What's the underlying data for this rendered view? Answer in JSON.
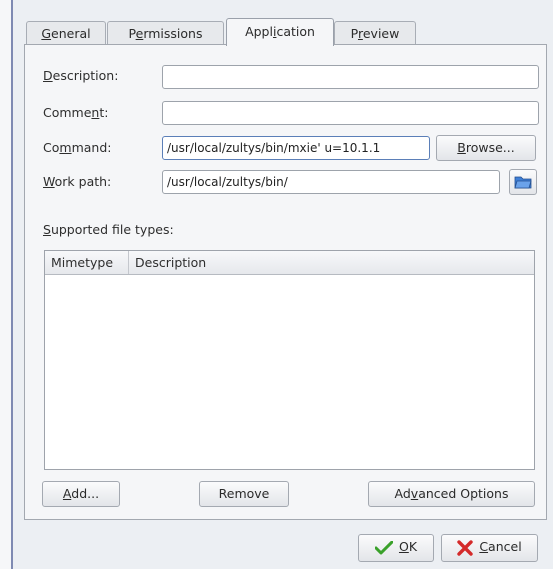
{
  "tabs": [
    {
      "label_pre": "",
      "label_ul": "G",
      "label_post": "eneral"
    },
    {
      "label_pre": "P",
      "label_ul": "e",
      "label_post": "rmissions"
    },
    {
      "label_pre": "Appl",
      "label_ul": "i",
      "label_post": "cation"
    },
    {
      "label_pre": "P",
      "label_ul": "r",
      "label_post": "eview"
    }
  ],
  "form": {
    "description": {
      "label_pre": "",
      "label_ul": "D",
      "label_post": "escription:",
      "value": ""
    },
    "comment": {
      "label_pre": "Comme",
      "label_ul": "n",
      "label_post": "t:",
      "value": ""
    },
    "command": {
      "label_pre": "Co",
      "label_ul": "m",
      "label_post": "mand:",
      "value": "/usr/local/zultys/bin/mxie' u=10.1.1"
    },
    "work_path": {
      "label_pre": "",
      "label_ul": "W",
      "label_post": "ork path:",
      "value": "/usr/local/zultys/bin/"
    },
    "browse": {
      "label_pre": "",
      "label_ul": "B",
      "label_post": "rowse..."
    }
  },
  "file_types": {
    "title_pre": "",
    "title_ul": "S",
    "title_post": "upported file types:",
    "columns": [
      "Mimetype",
      "Description"
    ],
    "rows": []
  },
  "actions": {
    "add": {
      "label_pre": "",
      "label_ul": "A",
      "label_post": "dd..."
    },
    "remove": "Remove",
    "advanced": {
      "label_pre": "Ad",
      "label_ul": "v",
      "label_post": "anced Options"
    }
  },
  "dialog": {
    "ok": {
      "label_pre": "",
      "label_ul": "O",
      "label_post": "K"
    },
    "cancel": {
      "label_pre": "",
      "label_ul": "C",
      "label_post": "ancel"
    }
  },
  "colors": {
    "ok_icon": "#3aa12a",
    "cancel_icon": "#d42a2a",
    "folder_icon": "#3f7fd6"
  }
}
